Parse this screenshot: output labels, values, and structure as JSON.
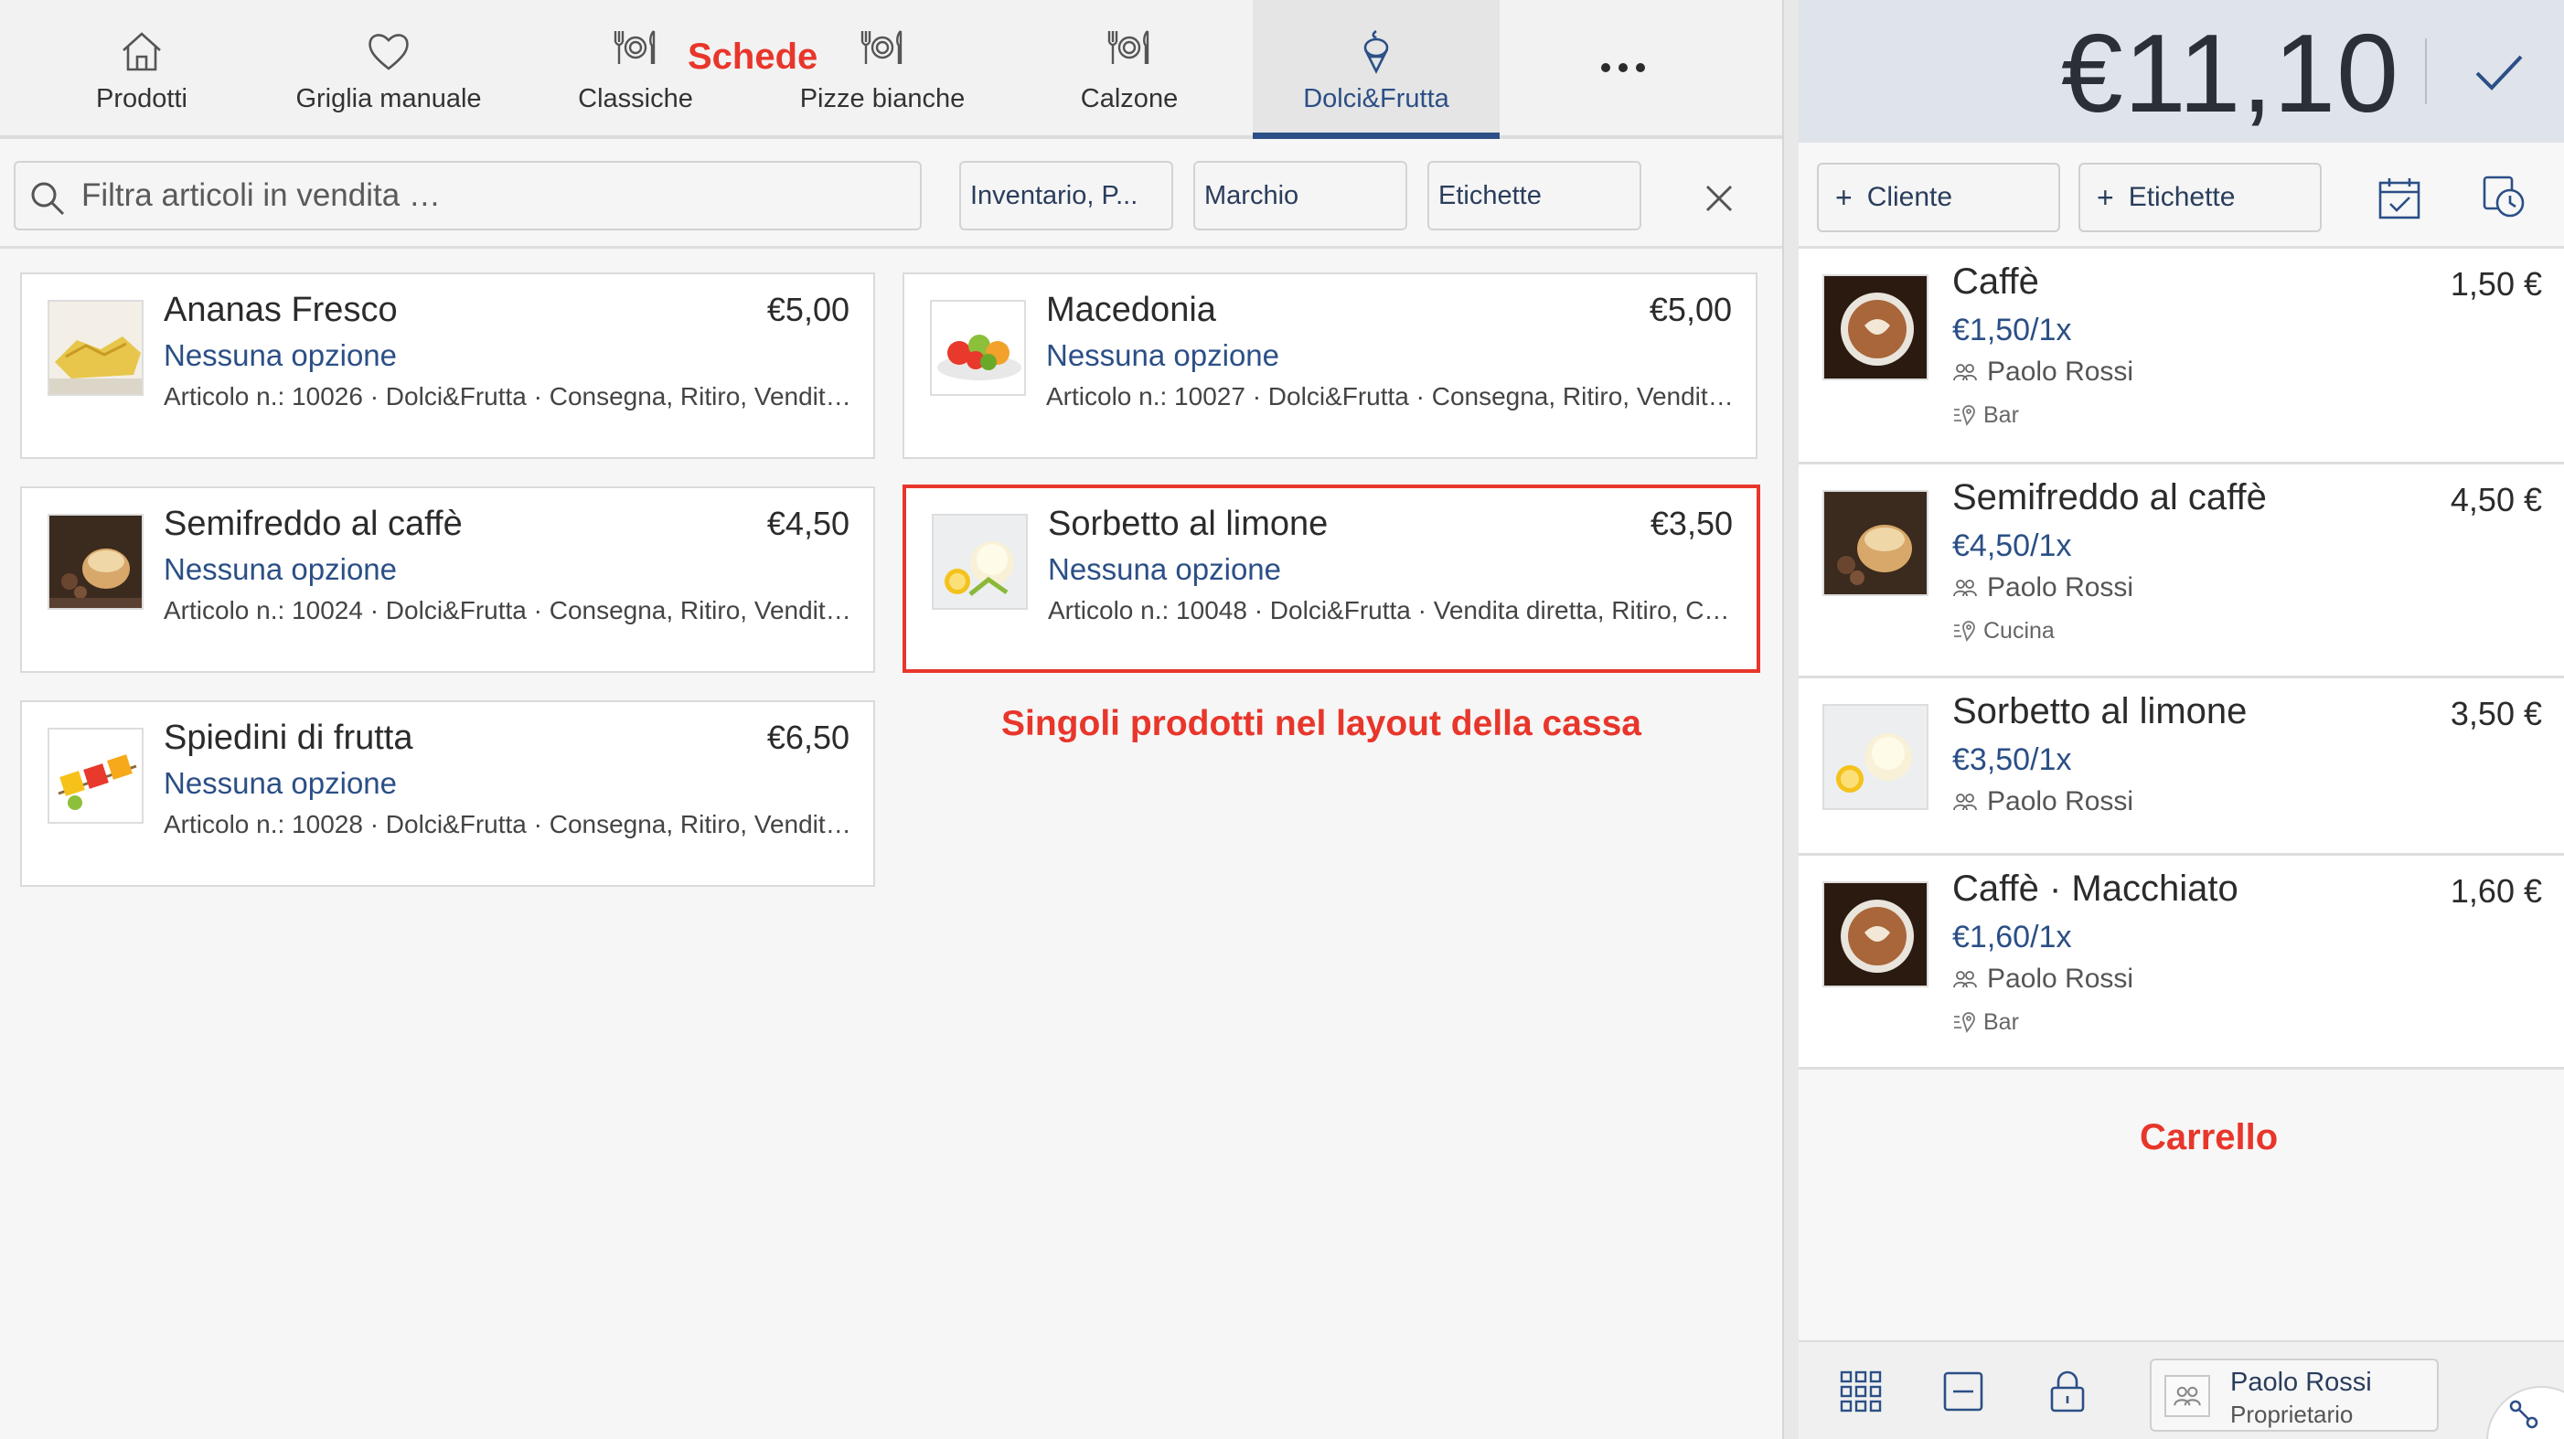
{
  "annotations": {
    "tabs": "Schede",
    "products": "Singoli prodotti nel layout della cassa",
    "cart": "Carrello"
  },
  "tabs": [
    {
      "label": "Prodotti",
      "icon": "home-icon"
    },
    {
      "label": "Griglia manuale",
      "icon": "heart-icon"
    },
    {
      "label": "Classiche",
      "icon": "cutlery-icon"
    },
    {
      "label": "Pizze bianche",
      "icon": "cutlery-icon"
    },
    {
      "label": "Calzone",
      "icon": "cutlery-icon"
    },
    {
      "label": "Dolci&Frutta",
      "icon": "ice-cream-icon",
      "active": true
    }
  ],
  "more_icon": "more-dots-icon",
  "filter": {
    "search_placeholder": "Filtra articoli in vendita …",
    "chips": [
      "Inventario, P...",
      "Marchio",
      "Etichette"
    ]
  },
  "products": [
    {
      "name": "Ananas Fresco",
      "price": "€5,00",
      "option": "Nessuna opzione",
      "meta": "Articolo n.: 10026 · Dolci&Frutta · Consegna, Ritiro, Vendita diretta"
    },
    {
      "name": "Macedonia",
      "price": "€5,00",
      "option": "Nessuna opzione",
      "meta": "Articolo n.: 10027 · Dolci&Frutta · Consegna, Ritiro, Vendita diretta"
    },
    {
      "name": "Semifreddo al caffè",
      "price": "€4,50",
      "option": "Nessuna opzione",
      "meta": "Articolo n.: 10024 · Dolci&Frutta · Consegna, Ritiro, Vendita diretta"
    },
    {
      "name": "Sorbetto al limone",
      "price": "€3,50",
      "option": "Nessuna opzione",
      "meta": "Articolo n.: 10048 · Dolci&Frutta · Vendita diretta, Ritiro, Consegna",
      "highlighted": true
    },
    {
      "name": "Spiedini di frutta",
      "price": "€6,50",
      "option": "Nessuna opzione",
      "meta": "Articolo n.: 10028 · Dolci&Frutta · Consegna, Ritiro, Vendita diretta"
    }
  ],
  "total": "€11,10",
  "cart_actions": {
    "customer": "Cliente",
    "tags": "Etichette"
  },
  "cart": [
    {
      "name": "Caffè",
      "price": "1,50 €",
      "unit": "€1,50/1x",
      "user": "Paolo Rossi",
      "dest": "Bar"
    },
    {
      "name": "Semifreddo al caffè",
      "price": "4,50 €",
      "unit": "€4,50/1x",
      "user": "Paolo Rossi",
      "dest": "Cucina"
    },
    {
      "name": "Sorbetto al limone",
      "price": "3,50 €",
      "unit": "€3,50/1x",
      "user": "Paolo Rossi",
      "dest": ""
    },
    {
      "name": "Caffè · Macchiato",
      "price": "1,60 €",
      "unit": "€1,60/1x",
      "user": "Paolo Rossi",
      "dest": "Bar"
    }
  ],
  "user": {
    "name": "Paolo Rossi",
    "role": "Proprietario"
  },
  "colors": {
    "accent": "#2b4f86",
    "annotation": "#e8362b",
    "total_bg": "#dfe3ea"
  }
}
